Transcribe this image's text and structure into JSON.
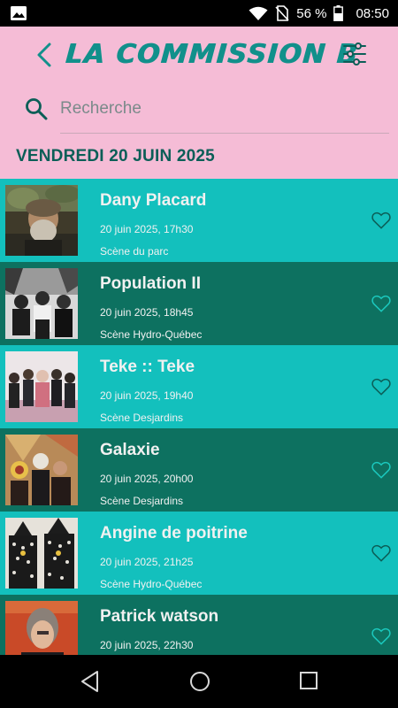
{
  "status_bar": {
    "battery": "56 %",
    "time": "08:50",
    "icons": [
      "image-icon",
      "wifi-icon",
      "no-sim-icon",
      "battery-icon"
    ]
  },
  "header": {
    "title": "LA COMMISSION B",
    "back_icon": "chevron-left-icon",
    "filter_icon": "sliders-icon",
    "accent_color": "#11908b",
    "background_color": "#f5bcd6"
  },
  "search": {
    "placeholder": "Recherche",
    "value": "",
    "icon": "search-icon"
  },
  "date_header": "VENDREDI 20 JUIN 2025",
  "colors": {
    "row_light": "#13c0bd",
    "row_dark": "#0d7160",
    "text": "#f1f1f1"
  },
  "events": [
    {
      "artist": "Dany Placard",
      "datetime": "20 juin 2025, 17h30",
      "stage": "Scène du parc"
    },
    {
      "artist": "Population II",
      "datetime": "20 juin 2025, 18h45",
      "stage": "Scène Hydro-Québec"
    },
    {
      "artist": "Teke :: Teke",
      "datetime": "20 juin 2025, 19h40",
      "stage": "Scène Desjardins"
    },
    {
      "artist": "Galaxie",
      "datetime": "20 juin 2025, 20h00",
      "stage": "Scène Desjardins"
    },
    {
      "artist": "Angine de poitrine",
      "datetime": "20 juin 2025, 21h25",
      "stage": "Scène Hydro-Québec"
    },
    {
      "artist": "Patrick watson",
      "datetime": "20 juin 2025, 22h30",
      "stage": ""
    }
  ],
  "nav_bar": {
    "icons": [
      "nav-back-icon",
      "nav-home-icon",
      "nav-recents-icon"
    ]
  }
}
